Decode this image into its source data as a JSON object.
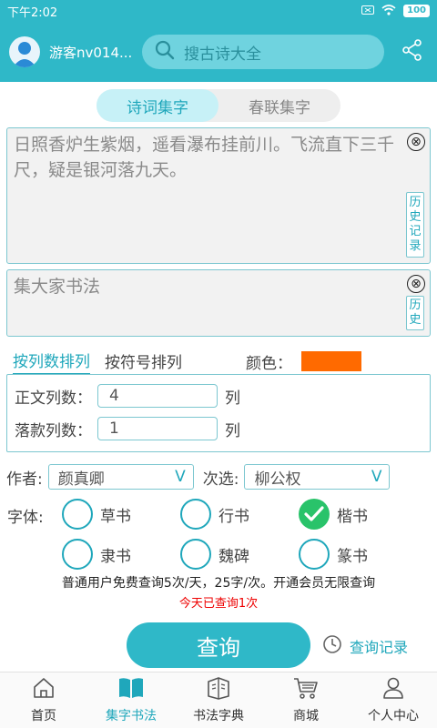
{
  "status_bar": {
    "time": "下午2:02",
    "battery": "100"
  },
  "header": {
    "user_name": "游客nv014...",
    "search_placeholder": "搜古诗大全"
  },
  "mode_tabs": [
    {
      "label": "诗词集字",
      "active": true
    },
    {
      "label": "春联集字",
      "active": false
    }
  ],
  "poem_input": {
    "value": "日照香炉生紫烟，遥看瀑布挂前川。飞流直下三千尺，疑是银河落九天。",
    "clear_icon": "⊗",
    "history_label": "历史记录"
  },
  "author_input": {
    "value": "集大家书法",
    "clear_icon": "⊗",
    "history_label": "历史"
  },
  "sort": {
    "by_column": "按列数排列",
    "by_symbol": "按符号排列",
    "active": "by_column",
    "color_label": "颜色：",
    "color": "#ff6a00"
  },
  "columns": {
    "body_label": "正文列数：",
    "body_value": "4",
    "sign_label": "落款列数：",
    "sign_value": "1",
    "unit": "列"
  },
  "selectors": {
    "author_label": "作者:",
    "author_value": "颜真卿",
    "secondary_label": "次选:",
    "secondary_value": "柳公权",
    "chevron": "V"
  },
  "font_styles": {
    "label": "字体:",
    "options": [
      {
        "label": "草书",
        "checked": false
      },
      {
        "label": "行书",
        "checked": false
      },
      {
        "label": "楷书",
        "checked": true
      },
      {
        "label": "隶书",
        "checked": false
      },
      {
        "label": "魏碑",
        "checked": false
      },
      {
        "label": "篆书",
        "checked": false
      }
    ]
  },
  "notice": "普通用户免费查询5次/天，25字/次。开通会员无限查询",
  "today_count": "今天已查询1次",
  "query_button": "查询",
  "history_link": "查询记录",
  "tabbar": [
    {
      "label": "首页",
      "icon": "home-icon",
      "active": false
    },
    {
      "label": "集字书法",
      "icon": "book-icon",
      "active": true
    },
    {
      "label": "书法字典",
      "icon": "dictionary-icon",
      "active": false
    },
    {
      "label": "商城",
      "icon": "cart-icon",
      "active": false
    },
    {
      "label": "个人中心",
      "icon": "person-icon",
      "active": false
    }
  ],
  "colors": {
    "accent": "#2fb8c8",
    "accent_text": "#1fa7bb",
    "checked": "#29c36a",
    "alert": "#e00000"
  }
}
